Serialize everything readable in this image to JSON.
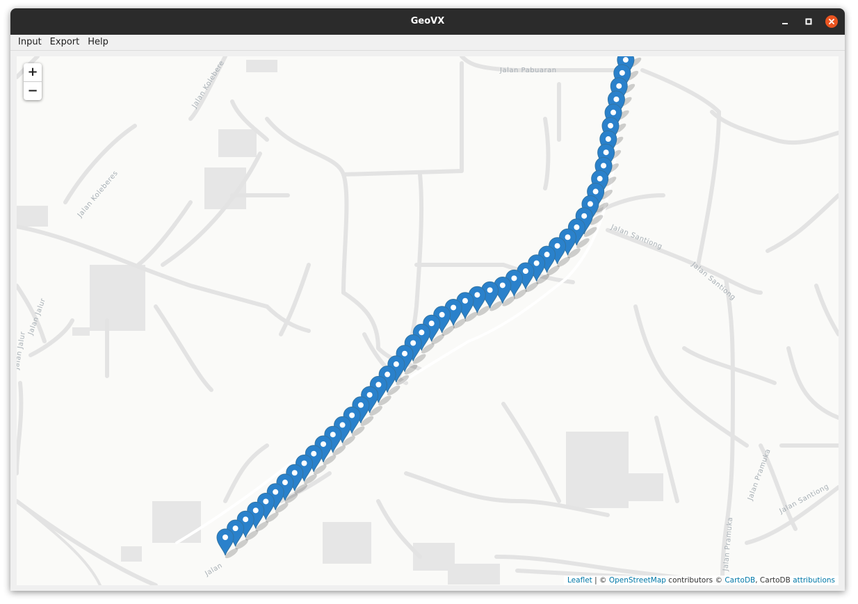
{
  "window": {
    "title": "GeoVX"
  },
  "menu": {
    "items": [
      "Input",
      "Export",
      "Help"
    ]
  },
  "zoom": {
    "in_label": "+",
    "out_label": "−"
  },
  "attribution": {
    "leaflet": "Leaflet",
    "sep1": " | © ",
    "osm": "OpenStreetMap",
    "mid": " contributors © ",
    "cartodb": "CartoDB",
    "mid2": ", CartoDB ",
    "attributions": "attributions"
  },
  "streets": [
    "Jalan Pabuaran",
    "Jalan Kolebere",
    "Jalan Koleberes",
    "Jalan Jalur",
    "Jalan Jalur",
    "Jalan Santiong",
    "Jalan Santiong",
    "Jalan Santiong",
    "Jalan Pramuka",
    "Jalan Pramuka",
    "Jalan Pelabuhan",
    "Jalan"
  ],
  "colors": {
    "marker": "#2a81cb",
    "marker_dark": "#3274a3",
    "close_button": "#e95420",
    "titlebar": "#2b2b2b",
    "link": "#0078a8"
  },
  "marker_count": 50
}
